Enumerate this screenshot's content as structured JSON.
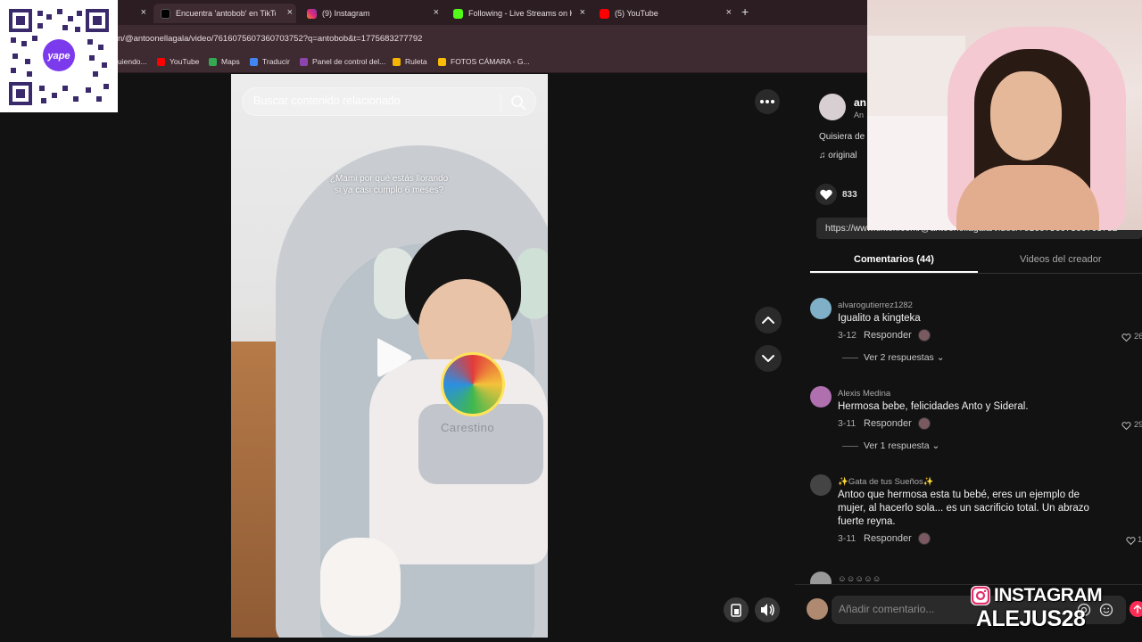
{
  "browser": {
    "tabs": [
      {
        "label": "",
        "close": "×"
      },
      {
        "label": "Encuentra 'antobob' en TikTok |",
        "close": "×",
        "color": "#000000"
      },
      {
        "label": "(9) Instagram",
        "close": "×",
        "color": "#e1306c"
      },
      {
        "label": "Following - Live Streams on Kic",
        "close": "×",
        "color": "#53fc18"
      },
      {
        "label": "(5) YouTube",
        "close": "×",
        "color": "#ff0000"
      }
    ],
    "new_tab": "+",
    "url": "n/@antoonellagala/video/7616075607360703752?q=antobob&t=1775683277792",
    "bookmarks": [
      {
        "label": "uiendo...",
        "color": "#555555"
      },
      {
        "label": "YouTube",
        "color": "#ff0000"
      },
      {
        "label": "Maps",
        "color": "#34a853"
      },
      {
        "label": "Traducir",
        "color": "#4285f4"
      },
      {
        "label": "Panel de control del...",
        "color": "#8e44ad"
      },
      {
        "label": "Ruleta",
        "color": "#f4b400"
      },
      {
        "label": "FOTOS CÁMARA - G...",
        "color": "#fbbc05"
      }
    ]
  },
  "qr": {
    "brand": "yape"
  },
  "video": {
    "search_placeholder": "Buscar contenido relacionado",
    "caption_line1": "¿Mami por qué estás llorando",
    "caption_line2": "si ya casi cumplo 6 meses?",
    "strap_text": "Carestino"
  },
  "panel": {
    "author_name": "an",
    "author_sub": "An",
    "description": "Quisiera de",
    "music_note": "♫",
    "music": "original",
    "likes": "833",
    "link": "https://www.tiktok.com/@antoonellagala/video/7616075607360703752",
    "tabs": [
      {
        "label": "Comentarios (44)"
      },
      {
        "label": "Videos del creador"
      }
    ]
  },
  "comments": [
    {
      "user": "alvarogutierrez1282",
      "text": "Igualito a kingteka",
      "date": "3-12",
      "reply": "Responder",
      "likes": "26",
      "replies_label": "Ver 2 respuestas ⌄",
      "avatar_color": "#7fb0c8"
    },
    {
      "user": "Alexis Medina",
      "text": "Hermosa bebe, felicidades Anto y Sideral.",
      "date": "3-11",
      "reply": "Responder",
      "likes": "29",
      "replies_label": "Ver 1 respuesta ⌄",
      "avatar_color": "#b070b0"
    },
    {
      "user": "✨Gata de tus Sueños✨",
      "text_line1": "Antoo que hermosa esta tu bebé, eres un ejemplo de",
      "text_line2": "mujer, al hacerlo sola... es un sacrificio total. Un abrazo",
      "text_line3": "fuerte reyna.",
      "date": "3-11",
      "reply": "Responder",
      "likes": "1",
      "avatar_color": "#444444"
    },
    {
      "user": "☺☺☺☺☺",
      "avatar_color": "#999999"
    }
  ],
  "composer": {
    "placeholder": "Añadir comentario..."
  },
  "overlay": {
    "instagram": "INSTAGRAM",
    "handle": "ALEJUS28"
  }
}
